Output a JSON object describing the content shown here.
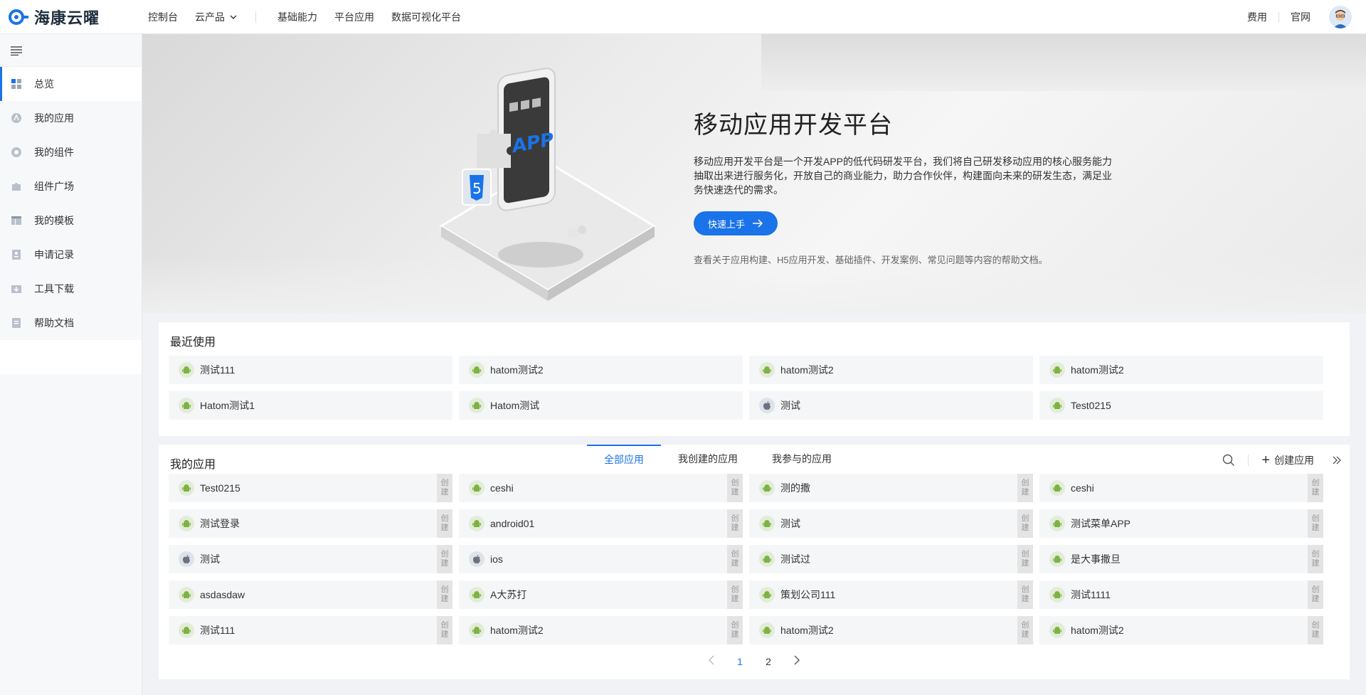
{
  "topbar": {
    "brand": "海康云曜",
    "nav": [
      "控制台",
      "云产品",
      "基础能力",
      "平台应用",
      "数据可视化平台"
    ],
    "right_links": [
      "费用",
      "官网"
    ]
  },
  "sidebar": {
    "items": [
      {
        "label": "总览",
        "icon": "overview-icon"
      },
      {
        "label": "我的应用",
        "icon": "app-icon"
      },
      {
        "label": "我的组件",
        "icon": "component-icon"
      },
      {
        "label": "组件广场",
        "icon": "puzzle-icon"
      },
      {
        "label": "我的模板",
        "icon": "template-icon"
      },
      {
        "label": "申请记录",
        "icon": "record-icon"
      },
      {
        "label": "工具下载",
        "icon": "download-icon"
      },
      {
        "label": "帮助文档",
        "icon": "doc-icon"
      }
    ]
  },
  "banner": {
    "title": "移动应用开发平台",
    "description": "移动应用开发平台是一个开发APP的低代码研发平台，我们将自己研发移动应用的核心服务能力抽取出来进行服务化，开放自己的商业能力，助力合作伙伴，构建面向未来的研发生态，满足业务快速迭代的需求。",
    "button": "快速上手",
    "note": "查看关于应用构建、H5应用开发、基础插件、开发案例、常见问题等内容的帮助文档。",
    "phone_label": "APP"
  },
  "recent": {
    "title": "最近使用",
    "apps": [
      {
        "name": "测试111",
        "platform": "android"
      },
      {
        "name": "hatom测试2",
        "platform": "android"
      },
      {
        "name": "hatom测试2",
        "platform": "android"
      },
      {
        "name": "hatom测试2",
        "platform": "android"
      },
      {
        "name": "Hatom测试1",
        "platform": "android"
      },
      {
        "name": "Hatom测试",
        "platform": "android"
      },
      {
        "name": "测试",
        "platform": "ios"
      },
      {
        "name": "Test0215",
        "platform": "android"
      }
    ]
  },
  "my_apps": {
    "title": "我的应用",
    "tabs": [
      "全部应用",
      "我创建的应用",
      "我参与的应用"
    ],
    "create_label": "创建应用",
    "tag": "创建",
    "apps": [
      {
        "name": "Test0215",
        "platform": "android"
      },
      {
        "name": "ceshi",
        "platform": "android"
      },
      {
        "name": "测的撒",
        "platform": "android"
      },
      {
        "name": "ceshi",
        "platform": "android"
      },
      {
        "name": "测试登录",
        "platform": "android"
      },
      {
        "name": "android01",
        "platform": "android"
      },
      {
        "name": "测试",
        "platform": "android"
      },
      {
        "name": "测试菜单APP",
        "platform": "android"
      },
      {
        "name": "测试",
        "platform": "ios"
      },
      {
        "name": "ios",
        "platform": "ios"
      },
      {
        "name": "测试过",
        "platform": "android"
      },
      {
        "name": "是大事撒旦",
        "platform": "android"
      },
      {
        "name": "asdasdaw",
        "platform": "android"
      },
      {
        "name": "A大苏打",
        "platform": "android"
      },
      {
        "name": "策划公司111",
        "platform": "android"
      },
      {
        "name": "测试1111",
        "platform": "android"
      },
      {
        "name": "测试111",
        "platform": "android"
      },
      {
        "name": "hatom测试2",
        "platform": "android"
      },
      {
        "name": "hatom测试2",
        "platform": "android"
      },
      {
        "name": "hatom测试2",
        "platform": "android"
      }
    ],
    "pages": [
      "1",
      "2"
    ],
    "current_page": "1"
  },
  "colors": {
    "accent": "#1a73e8",
    "android": "#7cb342"
  }
}
